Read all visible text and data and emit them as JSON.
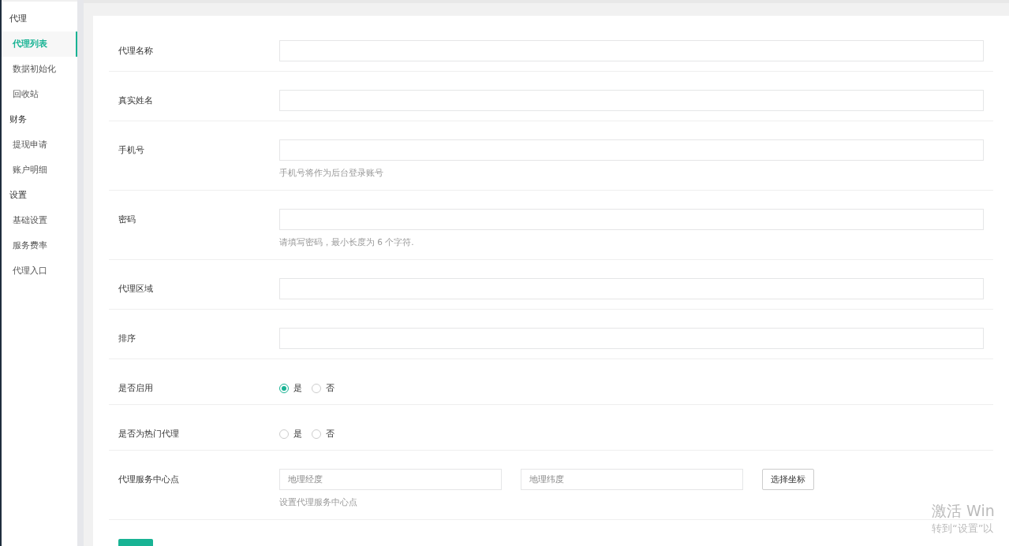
{
  "sidebar": {
    "groups": [
      {
        "title": "代理",
        "items": [
          {
            "label": "代理列表",
            "selected": true
          },
          {
            "label": "数据初始化",
            "selected": false
          },
          {
            "label": "回收站",
            "selected": false
          }
        ]
      },
      {
        "title": "财务",
        "items": [
          {
            "label": "提现申请",
            "selected": false
          },
          {
            "label": "账户明细",
            "selected": false
          }
        ]
      },
      {
        "title": "设置",
        "items": [
          {
            "label": "基础设置",
            "selected": false
          },
          {
            "label": "服务费率",
            "selected": false
          },
          {
            "label": "代理入口",
            "selected": false
          }
        ]
      }
    ]
  },
  "form": {
    "fields": [
      {
        "kind": "text",
        "label": "代理名称"
      },
      {
        "kind": "text",
        "label": "真实姓名"
      },
      {
        "kind": "text",
        "label": "手机号",
        "hint": "手机号将作为后台登录账号"
      },
      {
        "kind": "text",
        "label": "密码",
        "hint": "请填写密码，最小长度为 6 个字符."
      },
      {
        "kind": "text",
        "label": "代理区域"
      },
      {
        "kind": "text",
        "label": "排序"
      },
      {
        "kind": "radio",
        "label": "是否启用",
        "options": [
          {
            "label": "是",
            "selected": true
          },
          {
            "label": "否",
            "selected": false
          }
        ]
      },
      {
        "kind": "radio",
        "label": "是否为热门代理",
        "options": [
          {
            "label": "是",
            "selected": false
          },
          {
            "label": "否",
            "selected": false
          }
        ]
      },
      {
        "kind": "coords",
        "label": "代理服务中心点",
        "inputs": [
          {
            "placeholder": "地理经度"
          },
          {
            "placeholder": "地理纬度"
          }
        ],
        "button": "选择坐标",
        "hint": "设置代理服务中心点"
      }
    ]
  },
  "activation_notice": {
    "title": "激活 Win",
    "subtitle": "转到“设置”以"
  }
}
